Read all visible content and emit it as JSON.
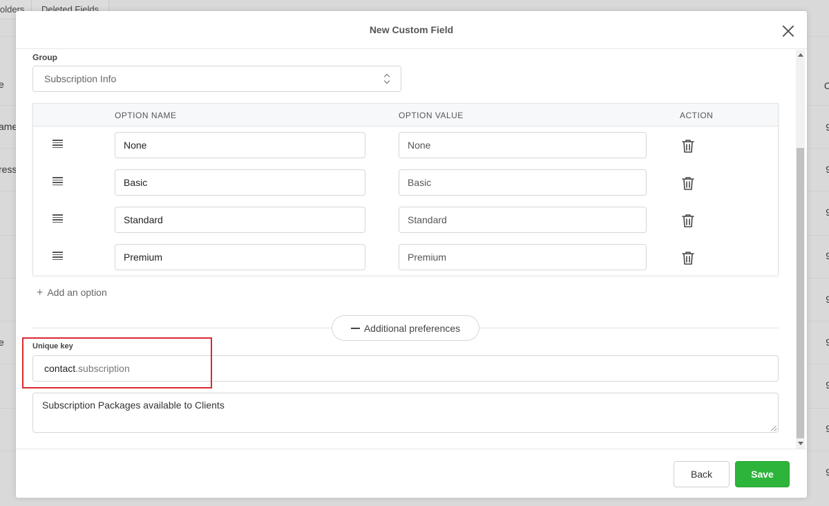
{
  "background": {
    "tabs": [
      "olders",
      "Deleted Fields"
    ],
    "left_fragments": [
      "e",
      "ame",
      "ress",
      "e"
    ],
    "right_fragments": [
      "C",
      "9",
      "9",
      "9",
      "9",
      "9",
      "9",
      "9",
      "9",
      "9"
    ]
  },
  "modal": {
    "title": "New Custom Field",
    "group": {
      "label": "Group",
      "value": "Subscription Info"
    },
    "options_table": {
      "headers": [
        "OPTION NAME",
        "OPTION VALUE",
        "ACTION"
      ],
      "rows": [
        {
          "name": "None",
          "value": "None"
        },
        {
          "name": "Basic",
          "value": "Basic"
        },
        {
          "name": "Standard",
          "value": "Standard"
        },
        {
          "name": "Premium",
          "value": "Premium"
        }
      ]
    },
    "add_option_label": "Add an option",
    "additional_preferences_label": "Additional preferences",
    "unique_key": {
      "label": "Unique key",
      "prefix": "contact",
      "suffix": ".subscription"
    },
    "description": "Subscription Packages available to Clients",
    "footer": {
      "back_label": "Back",
      "save_label": "Save"
    }
  },
  "colors": {
    "save_green": "#2db43b",
    "highlight_red": "#d9282f"
  },
  "icons": [
    "close-icon",
    "chevron-updown-icon",
    "drag-handle-icon",
    "trash-icon",
    "plus-icon",
    "minus-icon"
  ]
}
